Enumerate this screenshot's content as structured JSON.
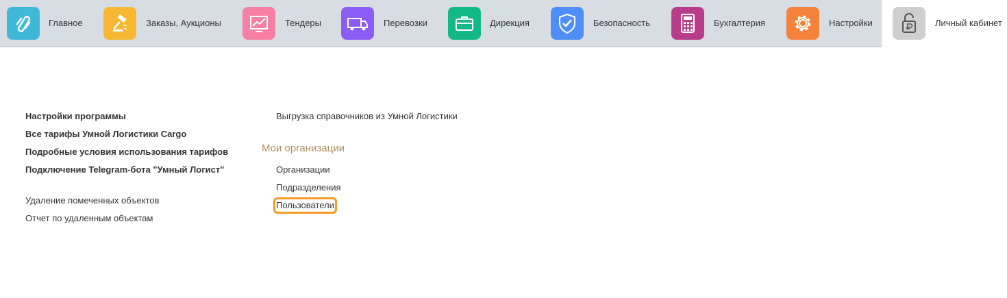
{
  "nav": {
    "items": [
      {
        "label": "Главное",
        "icon": "main-logo-icon",
        "color": "#3fb8d7"
      },
      {
        "label": "Заказы, Аукционы",
        "icon": "gavel-icon",
        "color": "#f7b733"
      },
      {
        "label": "Тендеры",
        "icon": "chart-icon",
        "color": "#f77fa6"
      },
      {
        "label": "Перевозки",
        "icon": "truck-icon",
        "color": "#8b5cf6"
      },
      {
        "label": "Дирекция",
        "icon": "briefcase-icon",
        "color": "#12b886"
      },
      {
        "label": "Безопасность",
        "icon": "shield-icon",
        "color": "#4f8ef7"
      },
      {
        "label": "Бухгалтерия",
        "icon": "calculator-icon",
        "color": "#b83c8a"
      },
      {
        "label": "Настройки",
        "icon": "gear-icon",
        "color": "#f5823a"
      },
      {
        "label": "Личный кабинет",
        "icon": "lock-ruble-icon",
        "color": "#cfcfcf"
      }
    ],
    "active_index": 8
  },
  "left": {
    "bold_links": [
      "Настройки программы",
      "Все тарифы Умной Логистики Cargo",
      "Подробные условия использования тарифов",
      "Подключение Telegram-бота \"Умный Логист\""
    ],
    "links": [
      "Удаление помеченных объектов",
      "Отчет по удаленным объектам"
    ]
  },
  "right": {
    "top_link": "Выгрузка справочников из Умной Логистики",
    "group_title": "Мои организации",
    "group_links": [
      "Организации",
      "Подразделения",
      "Пользователи"
    ],
    "focused_link": "Пользователи"
  },
  "colors": {
    "focus": "#f59a23",
    "group_title": "#b08d5c",
    "topbar": "#d7dde2"
  }
}
